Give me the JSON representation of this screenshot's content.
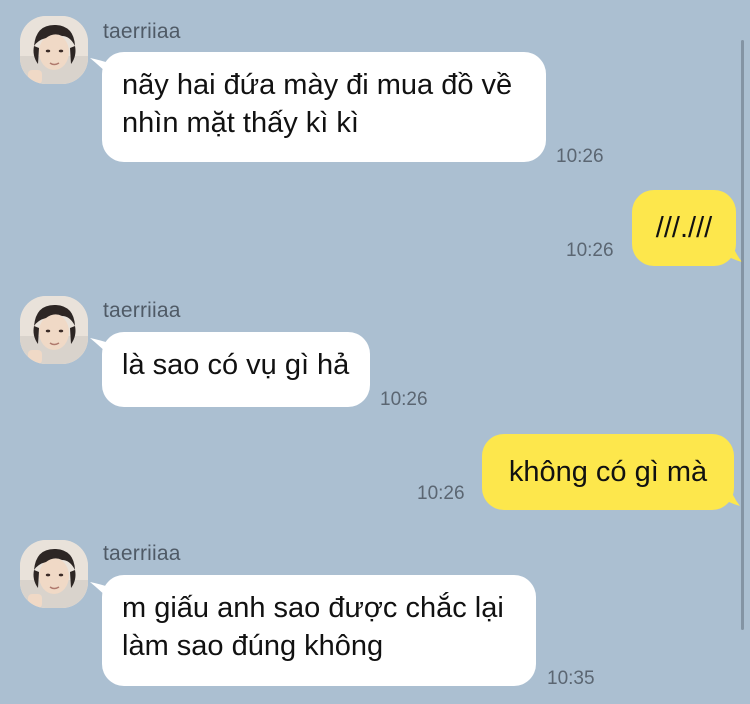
{
  "theme": {
    "background": "#abbfd1",
    "incoming_bubble": "#ffffff",
    "outgoing_bubble": "#fde74c",
    "timestamp_color": "#5b6672"
  },
  "messages": [
    {
      "direction": "incoming",
      "sender": "taerriiaa",
      "avatar": "profile-photo",
      "lines": [
        "nãy hai đứa mày đi mua đồ về",
        "nhìn mặt thấy kì kì"
      ],
      "time": "10:26"
    },
    {
      "direction": "outgoing",
      "lines": [
        "///.///"
      ],
      "time": "10:26"
    },
    {
      "direction": "incoming",
      "sender": "taerriiaa",
      "avatar": "profile-photo",
      "lines": [
        "là sao có vụ gì hả"
      ],
      "time": "10:26"
    },
    {
      "direction": "outgoing",
      "lines": [
        "không có gì mà"
      ],
      "time": "10:26"
    },
    {
      "direction": "incoming",
      "sender": "taerriiaa",
      "avatar": "profile-photo",
      "lines": [
        "m giấu anh sao được chắc lại",
        "làm sao đúng không"
      ],
      "time": "10:35"
    }
  ]
}
